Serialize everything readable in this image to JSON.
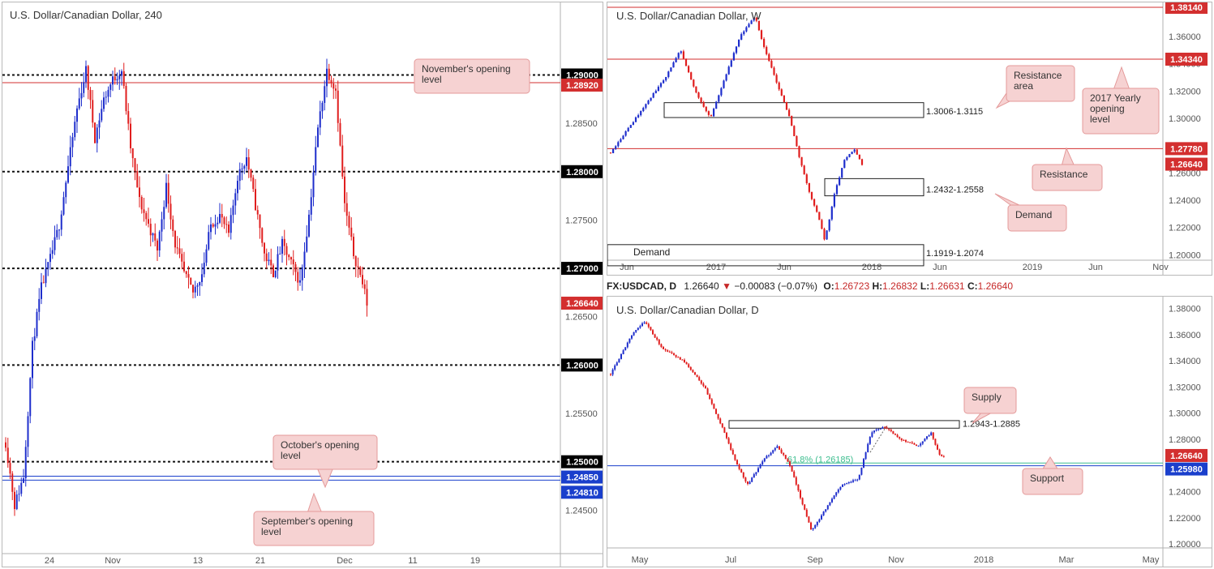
{
  "colors": {
    "bull": "#1e2ecc",
    "bear": "#e01e1e",
    "red_line": "#d32f2f",
    "blue_line": "#1a3fcc",
    "callout_fill": "#f6d2d2",
    "callout_stroke": "#e49a9a",
    "fib": "#3dbe8f",
    "axis_text": "#555555"
  },
  "panels": {
    "h4": {
      "title": "U.S. Dollar/Canadian Dollar, 240",
      "y_ticks": [
        "1.28500",
        "1.27500",
        "1.25500",
        "1.24500",
        "1.26500"
      ],
      "x_ticks": [
        "24",
        "Nov",
        "13",
        "21",
        "Dec",
        "11",
        "19"
      ],
      "price_labels": {
        "l12900": "1.29000",
        "l12892": "1.28920",
        "l12800": "1.28000",
        "l12700": "1.27000",
        "l12664": "1.26640",
        "l12600": "1.26000",
        "l12500": "1.25000",
        "l12485": "1.24850",
        "l12481": "1.24810"
      },
      "callouts": {
        "november": "November's opening level",
        "october": "October's opening level",
        "september": "September's opening level"
      }
    },
    "weekly": {
      "title": "U.S. Dollar/Canadian Dollar, W",
      "y_ticks": [
        "1.36000",
        "1.34000",
        "1.32000",
        "1.30000",
        "1.26000",
        "1.24000",
        "1.22000",
        "1.20000"
      ],
      "x_ticks": [
        "Jun",
        "2017",
        "Jun",
        "2018",
        "Jun",
        "2019",
        "Jun",
        "Nov"
      ],
      "price_labels": {
        "l13814": "1.38140",
        "l13434": "1.34340",
        "l12778": "1.27780",
        "l12664": "1.26640"
      },
      "zones": {
        "resistance_zone": "1.3006-1.3115",
        "demand_zone": "1.2432-1.2558",
        "demand_low": "1.1919-1.2074",
        "demand_label": "Demand"
      },
      "callouts": {
        "resistance_area": "Resistance area",
        "yearly": "2017 Yearly opening level",
        "resistance": "Resistance",
        "demand": "Demand"
      }
    },
    "daily": {
      "infobar": {
        "symbol": "FX:USDCAD, D",
        "last": "1.26640",
        "change": "−0.00083 (−0.07%)",
        "o_lab": "O:",
        "o_val": "1.26723",
        "h_lab": "H:",
        "h_val": "1.26832",
        "l_lab": "L:",
        "l_val": "1.26631",
        "c_lab": "C:",
        "c_val": "1.26640"
      },
      "title": "U.S. Dollar/Canadian Dollar, D",
      "y_ticks": [
        "1.38000",
        "1.36000",
        "1.34000",
        "1.32000",
        "1.30000",
        "1.28000",
        "1.24000",
        "1.22000",
        "1.20000"
      ],
      "x_ticks": [
        "May",
        "Jul",
        "Sep",
        "Nov",
        "2018",
        "Mar",
        "May"
      ],
      "price_labels": {
        "l12664": "1.26640",
        "l12598": "1.25980"
      },
      "zones": {
        "supply_zone": "1.2943-1.2885"
      },
      "fib_label": "61.8% (1.26185)",
      "callouts": {
        "supply": "Supply",
        "support": "Support"
      }
    }
  },
  "chart_data": [
    {
      "type": "candlestick",
      "title": "U.S. Dollar/Canadian Dollar, 240",
      "ylim": [
        1.2405,
        1.2975
      ],
      "x_ticks": [
        "24",
        "Nov",
        "13",
        "21",
        "Dec",
        "11",
        "19"
      ],
      "levels": [
        1.29,
        1.2892,
        1.28,
        1.27,
        1.2664,
        1.26,
        1.25,
        1.2485,
        1.2481
      ],
      "path": [
        [
          0,
          1.252
        ],
        [
          4,
          1.2455
        ],
        [
          8,
          1.2485
        ],
        [
          12,
          1.262
        ],
        [
          16,
          1.268
        ],
        [
          20,
          1.271
        ],
        [
          24,
          1.2745
        ],
        [
          28,
          1.2805
        ],
        [
          32,
          1.2865
        ],
        [
          36,
          1.2905
        ],
        [
          40,
          1.2835
        ],
        [
          44,
          1.2875
        ],
        [
          48,
          1.2895
        ],
        [
          52,
          1.2905
        ],
        [
          56,
          1.2825
        ],
        [
          60,
          1.277
        ],
        [
          64,
          1.2745
        ],
        [
          68,
          1.272
        ],
        [
          72,
          1.2785
        ],
        [
          76,
          1.2725
        ],
        [
          80,
          1.2695
        ],
        [
          84,
          1.2675
        ],
        [
          88,
          1.2695
        ],
        [
          92,
          1.2745
        ],
        [
          96,
          1.2755
        ],
        [
          100,
          1.2735
        ],
        [
          104,
          1.2795
        ],
        [
          108,
          1.2815
        ],
        [
          112,
          1.2765
        ],
        [
          116,
          1.2715
        ],
        [
          120,
          1.2695
        ],
        [
          124,
          1.2725
        ],
        [
          128,
          1.2705
        ],
        [
          132,
          1.2685
        ],
        [
          136,
          1.2755
        ],
        [
          140,
          1.2845
        ],
        [
          144,
          1.2905
        ],
        [
          148,
          1.2885
        ],
        [
          152,
          1.2765
        ],
        [
          156,
          1.2715
        ],
        [
          160,
          1.2685
        ],
        [
          162,
          1.2664
        ]
      ]
    },
    {
      "type": "candlestick",
      "title": "U.S. Dollar/Canadian Dollar, W",
      "ylim": [
        1.196,
        1.385
      ],
      "x_ticks": [
        "Jun",
        "2017",
        "Jun",
        "2018",
        "Jun",
        "2019",
        "Jun",
        "Nov"
      ],
      "levels": [
        1.3814,
        1.3434,
        1.2778,
        1.2664
      ],
      "zones": [
        [
          1.3006,
          1.3115
        ],
        [
          1.2432,
          1.2558
        ],
        [
          1.1919,
          1.2074
        ]
      ],
      "path": [
        [
          0,
          1.275
        ],
        [
          6,
          1.29
        ],
        [
          14,
          1.31
        ],
        [
          22,
          1.33
        ],
        [
          28,
          1.35
        ],
        [
          34,
          1.32
        ],
        [
          40,
          1.3
        ],
        [
          46,
          1.33
        ],
        [
          52,
          1.36
        ],
        [
          58,
          1.375
        ],
        [
          62,
          1.35
        ],
        [
          66,
          1.33
        ],
        [
          72,
          1.3
        ],
        [
          76,
          1.27
        ],
        [
          80,
          1.245
        ],
        [
          84,
          1.225
        ],
        [
          86,
          1.21
        ],
        [
          90,
          1.245
        ],
        [
          94,
          1.27
        ],
        [
          98,
          1.277
        ],
        [
          101,
          1.2664
        ]
      ]
    },
    {
      "type": "candlestick",
      "title": "U.S. Dollar/Canadian Dollar, D",
      "ylim": [
        1.197,
        1.389
      ],
      "x_ticks": [
        "May",
        "Jul",
        "Sep",
        "Nov",
        "2018",
        "Mar",
        "May"
      ],
      "levels": [
        1.2664,
        1.2598,
        1.26185
      ],
      "zones": [
        [
          1.2885,
          1.2943
        ]
      ],
      "path": [
        [
          0,
          1.33
        ],
        [
          10,
          1.36
        ],
        [
          16,
          1.37
        ],
        [
          24,
          1.35
        ],
        [
          34,
          1.34
        ],
        [
          44,
          1.32
        ],
        [
          52,
          1.29
        ],
        [
          58,
          1.265
        ],
        [
          64,
          1.245
        ],
        [
          72,
          1.265
        ],
        [
          78,
          1.275
        ],
        [
          84,
          1.26
        ],
        [
          90,
          1.23
        ],
        [
          94,
          1.21
        ],
        [
          100,
          1.225
        ],
        [
          108,
          1.245
        ],
        [
          116,
          1.25
        ],
        [
          122,
          1.285
        ],
        [
          128,
          1.29
        ],
        [
          136,
          1.28
        ],
        [
          144,
          1.275
        ],
        [
          150,
          1.285
        ],
        [
          154,
          1.268
        ],
        [
          156,
          1.2664
        ]
      ]
    }
  ]
}
